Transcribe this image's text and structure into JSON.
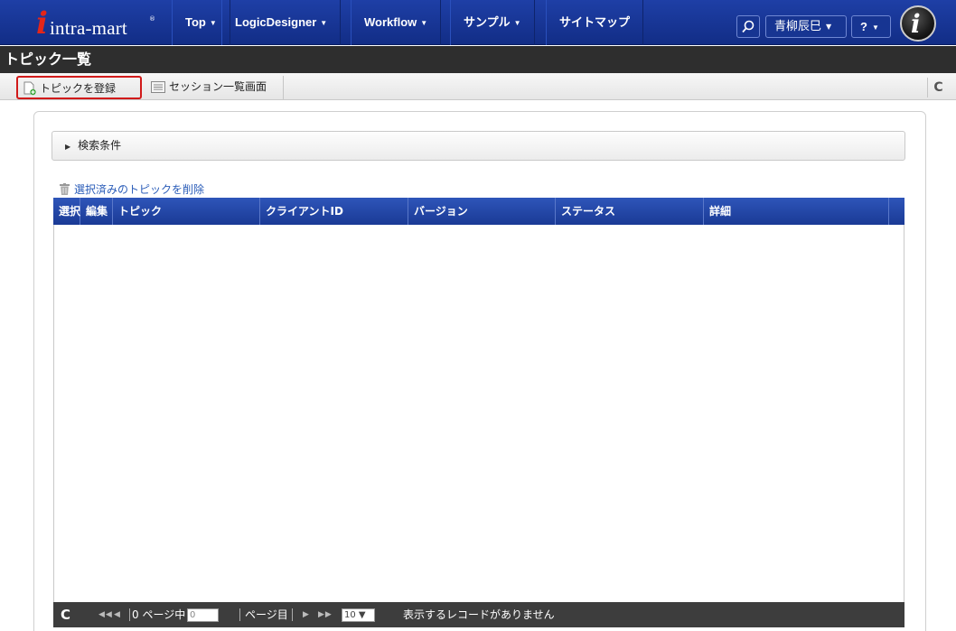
{
  "header": {
    "logo_text": "intra-mart",
    "logo_reg": "®",
    "nav": [
      {
        "label": "Top"
      },
      {
        "label": "LogicDesigner"
      },
      {
        "label": "Workflow"
      },
      {
        "label": "サンプル"
      },
      {
        "label": "サイトマップ"
      }
    ],
    "user_name": "青柳辰巳",
    "help_label": "?"
  },
  "page": {
    "title": "トピック一覧"
  },
  "toolbar": {
    "register_label": "トピックを登録",
    "session_list_label": "セッション一覧画面"
  },
  "search": {
    "label": "検索条件"
  },
  "actions": {
    "delete_selected_label": "選択済みのトピックを削除"
  },
  "grid": {
    "columns": [
      "選択",
      "編集",
      "トピック",
      "クライアントID",
      "バージョン",
      "ステータス",
      "詳細"
    ],
    "rows": []
  },
  "pager": {
    "page_count_text": "0 ページ中",
    "page_value": "0",
    "page_suffix": "ページ目",
    "rows_per_page": "10",
    "status_text": "表示するレコードがありません"
  },
  "colors": {
    "nav_bg": "#1e3fa6",
    "title_bg": "#2e2e2e",
    "highlight": "#d11a1a",
    "grid_header": "#2e55b9"
  }
}
